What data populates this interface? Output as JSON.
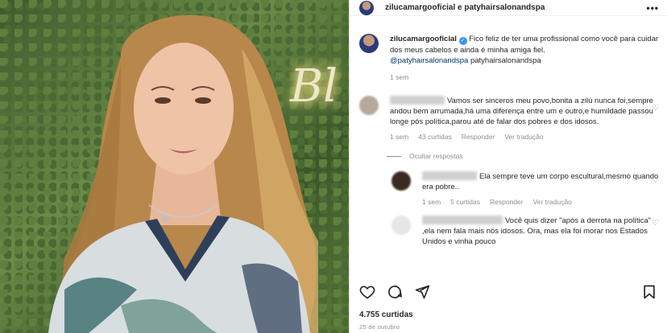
{
  "post": {
    "header_title": "zilucamargooficial e patyhairsalonandspa",
    "neon_sign": "Bl"
  },
  "caption": {
    "username": "zilucamargooficial",
    "text": "Fico feliz de ter uma profissional como você para cuidar dos meus cabelos e ainda é minha amiga fiel.",
    "mention": "@patyhairsalonandspa",
    "tag_text": "patyhairsalonandspa",
    "time": "1 sem"
  },
  "comments": [
    {
      "text": "Vamos ser sinceros meu povo,bonita a zilú nunca foi,sempre andou bem arrumada,há uma diferença entre um e outro,e humildade passou longe pós política,parou até de falar dos pobres e dos idosos.",
      "time": "1 sem",
      "likes": "43 curtidas",
      "reply": "Responder",
      "translate": "Ver tradução"
    }
  ],
  "hide_replies": "Ocultar respostas",
  "replies": [
    {
      "text": "Ela sempre teve um corpo escultural,mesmo quando era pobre..",
      "time": "1 sem",
      "likes": "5 curtidas",
      "reply": "Responder",
      "translate": "Ver tradução"
    },
    {
      "text": "Você quis dizer \"após a derrota na política\" ,ela nem fala mais nós idosos. Ora, mas ela foi morar nos Estados Unidos e vinha pouco"
    }
  ],
  "footer": {
    "likes": "4.755 curtidas",
    "date": "25 de outubro"
  }
}
